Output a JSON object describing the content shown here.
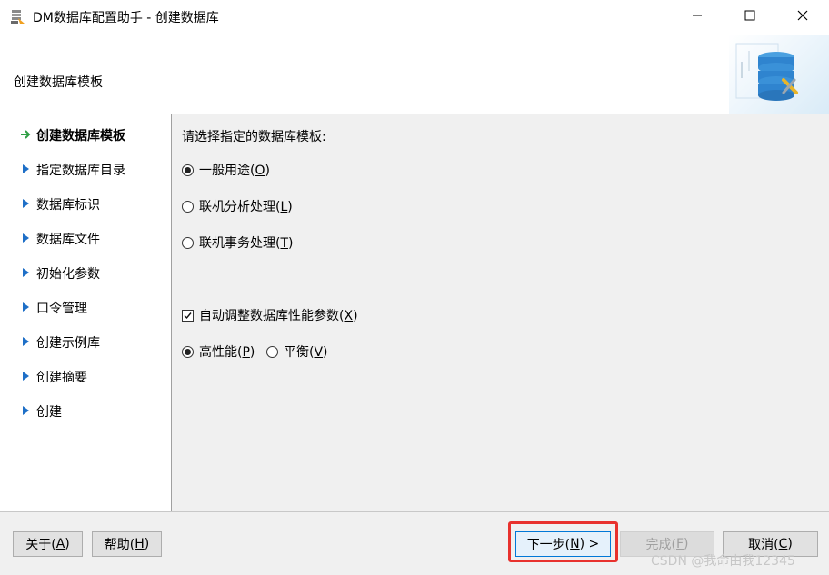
{
  "window": {
    "title": "DM数据库配置助手 - 创建数据库",
    "controls": [
      "minimize-icon",
      "maximize-icon",
      "close-icon"
    ]
  },
  "header": {
    "title": "创建数据库模板",
    "art_icon": "database-tools-icon"
  },
  "sidebar": {
    "items": [
      {
        "label": "创建数据库模板",
        "active": true,
        "marker": "arrow-right-icon"
      },
      {
        "label": "指定数据库目录",
        "active": false,
        "marker": "triangle-right-icon"
      },
      {
        "label": "数据库标识",
        "active": false,
        "marker": "triangle-right-icon"
      },
      {
        "label": "数据库文件",
        "active": false,
        "marker": "triangle-right-icon"
      },
      {
        "label": "初始化参数",
        "active": false,
        "marker": "triangle-right-icon"
      },
      {
        "label": "口令管理",
        "active": false,
        "marker": "triangle-right-icon"
      },
      {
        "label": "创建示例库",
        "active": false,
        "marker": "triangle-right-icon"
      },
      {
        "label": "创建摘要",
        "active": false,
        "marker": "triangle-right-icon"
      },
      {
        "label": "创建",
        "active": false,
        "marker": "triangle-right-icon"
      }
    ]
  },
  "main": {
    "prompt": "请选择指定的数据库模板:",
    "template_options": [
      {
        "text": "一般用途(",
        "key": "O",
        "tail": ")",
        "selected": true
      },
      {
        "text": "联机分析处理(",
        "key": "L",
        "tail": ")",
        "selected": false
      },
      {
        "text": "联机事务处理(",
        "key": "T",
        "tail": ")",
        "selected": false
      }
    ],
    "auto_tune": {
      "text": "自动调整数据库性能参数(",
      "key": "X",
      "tail": ")",
      "checked": true
    },
    "perf_options": [
      {
        "text": "高性能(",
        "key": "P",
        "tail": ")",
        "selected": true
      },
      {
        "text": "平衡(",
        "key": "V",
        "tail": ")",
        "selected": false
      }
    ]
  },
  "footer": {
    "about": {
      "text": "关于(",
      "key": "A",
      "tail": ")"
    },
    "help": {
      "text": "帮助(",
      "key": "H",
      "tail": ")"
    },
    "next": {
      "text": "下一步(",
      "key": "N",
      "tail": ") >"
    },
    "finish": {
      "text": "完成(",
      "key": "F",
      "tail": ")"
    },
    "cancel": {
      "text": "取消(",
      "key": "C",
      "tail": ")"
    }
  },
  "watermark": "CSDN @我命由我12345",
  "colors": {
    "accent": "#0078d7",
    "highlight": "#e8312d",
    "active_arrow": "#2e9e44",
    "triangle": "#1e6fc7"
  }
}
